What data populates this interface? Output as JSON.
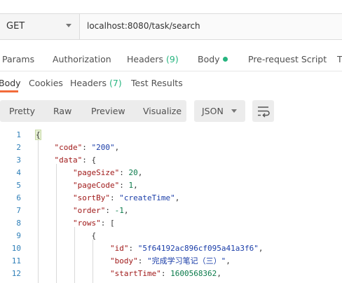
{
  "request": {
    "method": "GET",
    "url": "localhost:8080/task/search"
  },
  "request_tabs": {
    "params": "Params",
    "authorization": "Authorization",
    "headers": "Headers",
    "headers_count": "(9)",
    "body": "Body",
    "pre_request": "Pre-request Script",
    "tests_partial": "T"
  },
  "response_tabs": {
    "body": "Body",
    "cookies": "Cookies",
    "headers": "Headers",
    "headers_count": "(7)",
    "test_results": "Test Results"
  },
  "toolbar": {
    "pretty": "Pretty",
    "raw": "Raw",
    "preview": "Preview",
    "visualize": "Visualize",
    "format": "JSON"
  },
  "code": {
    "line_numbers": [
      "1",
      "2",
      "3",
      "4",
      "5",
      "6",
      "7",
      "8",
      "9",
      "10",
      "11",
      "12"
    ],
    "k_code": "\"code\"",
    "v_code": "\"200\"",
    "k_data": "\"data\"",
    "k_pageSize": "\"pageSize\"",
    "v_pageSize": "20",
    "k_pageCode": "\"pageCode\"",
    "v_pageCode": "1",
    "k_sortBy": "\"sortBy\"",
    "v_sortBy": "\"createTime\"",
    "k_order": "\"order\"",
    "v_order": "-1",
    "k_rows": "\"rows\"",
    "k_id": "\"id\"",
    "v_id": "\"5f64192ac896cf095a41a3f6\"",
    "k_body": "\"body\"",
    "v_body": "\"完成学习笔记（三）\"",
    "k_startTime": "\"startTime\"",
    "v_startTime": "1600568362"
  }
}
